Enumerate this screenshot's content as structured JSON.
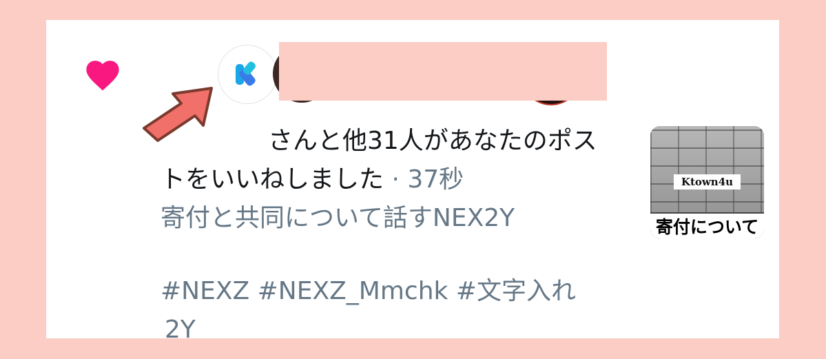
{
  "notification": {
    "line1": "さんと他31人があなたのポス",
    "line2_text": "トをいいねしました",
    "separator": " · ",
    "time": "37秒"
  },
  "post": {
    "title": "寄付と共同について話すNEX2Y",
    "hashtags": "#NEXZ #NEXZ_Mmchk #文字入れ",
    "tail": "2Y"
  },
  "thumbnail": {
    "label": "Ktown4u",
    "banner": "寄付について"
  },
  "icons": {
    "like": "heart-icon",
    "pointer": "arrow-annotation-icon",
    "app_avatar": "k-logo-icon"
  },
  "colors": {
    "background": "#fbcdc4",
    "heart": "#f91880",
    "arrow": "#f2706a",
    "muted_text": "#657786"
  }
}
